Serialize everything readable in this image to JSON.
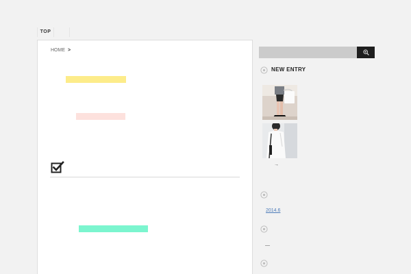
{
  "nav": {
    "top_label": "TOP"
  },
  "breadcrumb": {
    "home": "HOME",
    "separator": ">"
  },
  "highlights": {
    "yellow": "#fdec8a",
    "pink": "#fde1dd",
    "mint": "#7cf5cf"
  },
  "search": {
    "placeholder": "",
    "icon": "zoom-in-icon"
  },
  "sidebar": {
    "new_entry_heading": "NEW ENTRY",
    "more_link": "→",
    "archive_link": "2014.6",
    "dash_text": "—"
  }
}
